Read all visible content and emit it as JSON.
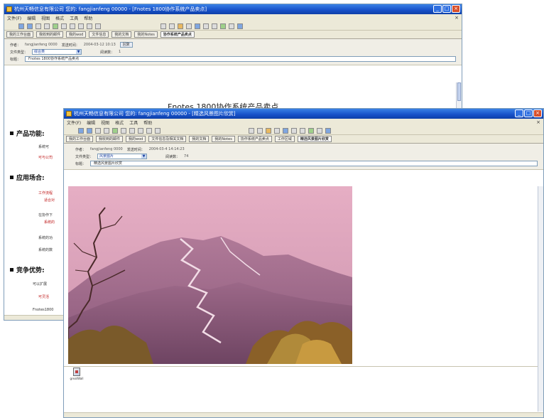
{
  "back_window": {
    "title": "杭州天畅信息有限公司 您的: fangjianfeng 00000 - [Fnotes 1800协作系统产品卖点]",
    "menu": [
      "文件(F)",
      "编辑",
      "视图",
      "格式",
      "工具",
      "帮助"
    ],
    "tabs": [
      "我的工作台面",
      "我收到的邮件",
      "我的wod",
      "文件信息",
      "我的文档",
      "我的Notes",
      "协作系统产品卖点"
    ],
    "active_tab": "协作系统产品卖点",
    "header": {
      "author_label": "作者：",
      "author_value": "fangjianfeng 0000",
      "date_label": "发送时间：",
      "date_value": "2004-03-12 10:13",
      "action_button": "回复",
      "category_label": "文件类型：",
      "category_value": "综合类",
      "count_label": "阅读数：",
      "count_value": "1",
      "subject_label": "标题：",
      "subject_value": "Fnotes 1800协作系统产品卖点"
    },
    "doc_title": "Fnotes 1800协作系统产品卖点",
    "sections": [
      "产品功能:",
      "应用场合:",
      "竞争优势:"
    ],
    "bullets": [
      "系统可",
      "可与公司",
      "工作流程",
      "适合对",
      "在协作下",
      "系统的",
      "系统的功",
      "系统的数",
      "可以扩展",
      "可灵活",
      "Fnotes1800"
    ]
  },
  "front_window": {
    "title": "杭州天畅信息有限公司 您的: fangjianfeng 00000 - [精选风景图片欣赏]",
    "menu": [
      "文件(F)",
      "编辑",
      "视图",
      "格式",
      "工具",
      "帮助"
    ],
    "tabs": [
      "我的工作台面",
      "我收到的邮件",
      "我的wod",
      "文件信息及相关文档",
      "我的文档",
      "我的Notes",
      "协作系统产品卖点",
      "工作区域",
      "精选风景图片欣赏"
    ],
    "active_tab": "精选风景图片欣赏",
    "header": {
      "author_label": "作者：",
      "author_value": "fangjianfeng 0000",
      "date_label": "发送时间：",
      "date_value": "2004-03-4 14:14:23",
      "category_label": "文件类型：",
      "category_value": "风景图片",
      "count_label": "阅读数：",
      "count_value": "74",
      "subject_label": "标题：",
      "subject_value": "精选风景图片欣赏"
    },
    "attachment_name": "greatWall"
  },
  "colors": {
    "titlebar": "#1750c8",
    "chrome": "#ece9d8",
    "accent_red": "#c02020",
    "sky": "#d8a0b8",
    "mountain": "#a06888"
  }
}
